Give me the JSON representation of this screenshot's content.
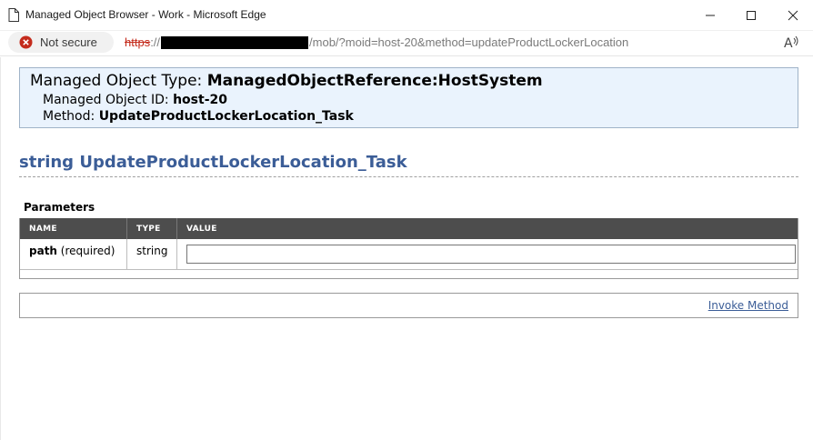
{
  "window": {
    "title": "Managed Object Browser - Work - Microsoft Edge",
    "icons": [
      "page-icon",
      "minimize-icon",
      "maximize-icon",
      "close-icon"
    ]
  },
  "address_bar": {
    "security_label": "Not secure",
    "security_icon": "not-secure-icon",
    "url_scheme": "https",
    "url_separator": "://",
    "url_path": "/mob/?moid=host-20&method=updateProductLockerLocation",
    "read_aloud_icon": "read-aloud-icon"
  },
  "header": {
    "type_label": "Managed Object Type:",
    "type_value": "ManagedObjectReference:HostSystem",
    "id_label": "Managed Object ID:",
    "id_value": "host-20",
    "method_label": "Method:",
    "method_value": "UpdateProductLockerLocation_Task"
  },
  "method_heading": "string UpdateProductLockerLocation_Task",
  "parameters": {
    "title": "Parameters",
    "columns": [
      "NAME",
      "TYPE",
      "VALUE"
    ],
    "rows": [
      {
        "name": "path",
        "qualifier": "(required)",
        "type": "string",
        "value": ""
      }
    ]
  },
  "invoke": {
    "label": "Invoke Method"
  },
  "colors": {
    "link": "#3b5d97",
    "header_bg": "#eaf3fd",
    "table_header_bg": "#4d4d4d",
    "not_secure": "#c42b1c"
  }
}
